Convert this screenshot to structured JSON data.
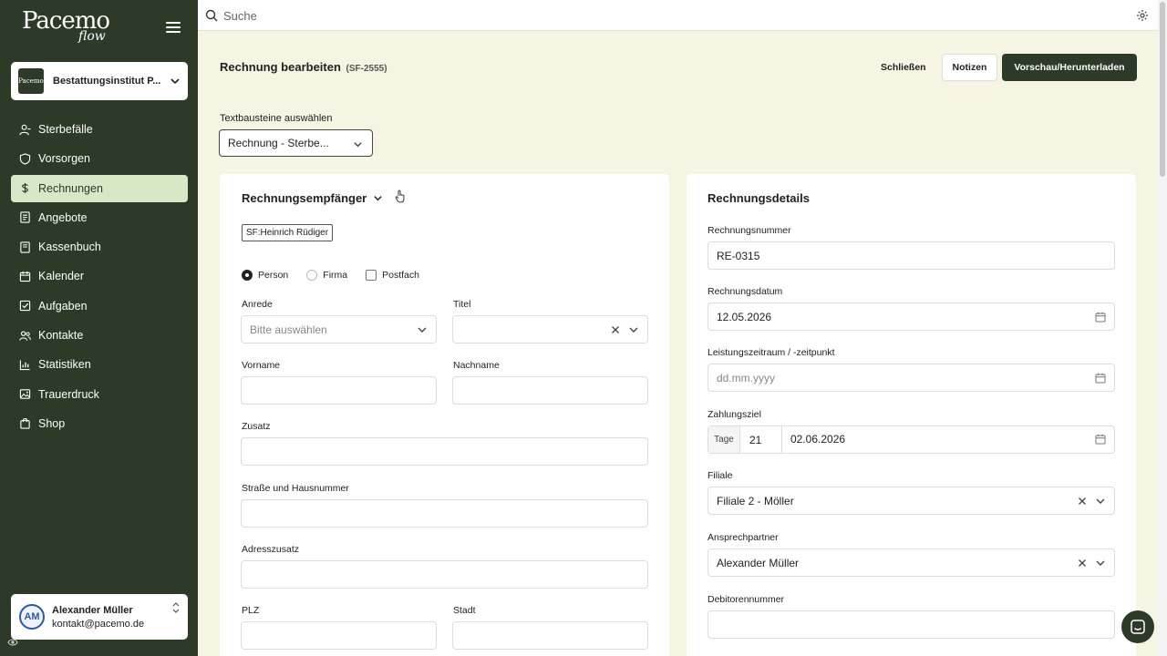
{
  "brand": {
    "logo_main": "Pacemo",
    "logo_sub": "flow"
  },
  "organization": {
    "logo_text": "Pacemo",
    "name": "Bestattungsinstitut P..."
  },
  "nav": [
    {
      "label": "Sterbefälle",
      "icon": "person-minus-icon",
      "active": false
    },
    {
      "label": "Vorsorgen",
      "icon": "shield-icon",
      "active": false
    },
    {
      "label": "Rechnungen",
      "icon": "dollar-icon",
      "active": true
    },
    {
      "label": "Angebote",
      "icon": "document-icon",
      "active": false
    },
    {
      "label": "Kassenbuch",
      "icon": "book-icon",
      "active": false
    },
    {
      "label": "Kalender",
      "icon": "calendar-icon",
      "active": false
    },
    {
      "label": "Aufgaben",
      "icon": "checkbox-icon",
      "active": false
    },
    {
      "label": "Kontakte",
      "icon": "contacts-icon",
      "active": false
    },
    {
      "label": "Statistiken",
      "icon": "bar-chart-icon",
      "active": false
    },
    {
      "label": "Trauerdruck",
      "icon": "image-icon",
      "active": false
    },
    {
      "label": "Shop",
      "icon": "shopping-bag-icon",
      "active": false
    }
  ],
  "user": {
    "initials": "AM",
    "name": "Alexander Müller",
    "email": "kontakt@pacemo.de"
  },
  "search": {
    "placeholder": "Suche"
  },
  "header": {
    "title": "Rechnung bearbeiten",
    "code": "(SF-2555)",
    "close_label": "Schließen",
    "notes_label": "Notizen",
    "preview_label": "Vorschau/Herunterladen"
  },
  "text_blocks": {
    "label": "Textbausteine auswählen",
    "selected": "Rechnung - Sterbe..."
  },
  "recipient": {
    "title": "Rechnungsempfänger",
    "tag": "SF:Heinrich Rüdiger",
    "types": [
      {
        "label": "Person",
        "kind": "radio",
        "checked": true
      },
      {
        "label": "Firma",
        "kind": "radio",
        "checked": false
      },
      {
        "label": "Postfach",
        "kind": "checkbox",
        "checked": false
      }
    ],
    "salutation_label": "Anrede",
    "salutation_placeholder": "Bitte auswählen",
    "title_label": "Titel",
    "title_value": "",
    "firstname_label": "Vorname",
    "firstname_value": "",
    "lastname_label": "Nachname",
    "lastname_value": "",
    "addition_label": "Zusatz",
    "addition_value": "",
    "street_label": "Straße und Hausnummer",
    "street_value": "",
    "address_extra_label": "Adresszusatz",
    "address_extra_value": "",
    "zip_label": "PLZ",
    "zip_value": "",
    "city_label": "Stadt",
    "city_value": ""
  },
  "details": {
    "title": "Rechnungsdetails",
    "number_label": "Rechnungsnummer",
    "number_value": "RE-0315",
    "date_label": "Rechnungsdatum",
    "date_value": "12.05.2026",
    "period_label": "Leistungszeitraum / -zeitpunkt",
    "period_placeholder": "dd.mm.yyyy",
    "payment_label": "Zahlungsziel",
    "payment_unit": "Tage",
    "payment_days": "21",
    "payment_date": "02.06.2026",
    "branch_label": "Filiale",
    "branch_value": "Filiale 2 - Möller",
    "contact_label": "Ansprechpartner",
    "contact_value": "Alexander Müller",
    "debtor_label": "Debitorennummer",
    "debtor_value": ""
  }
}
